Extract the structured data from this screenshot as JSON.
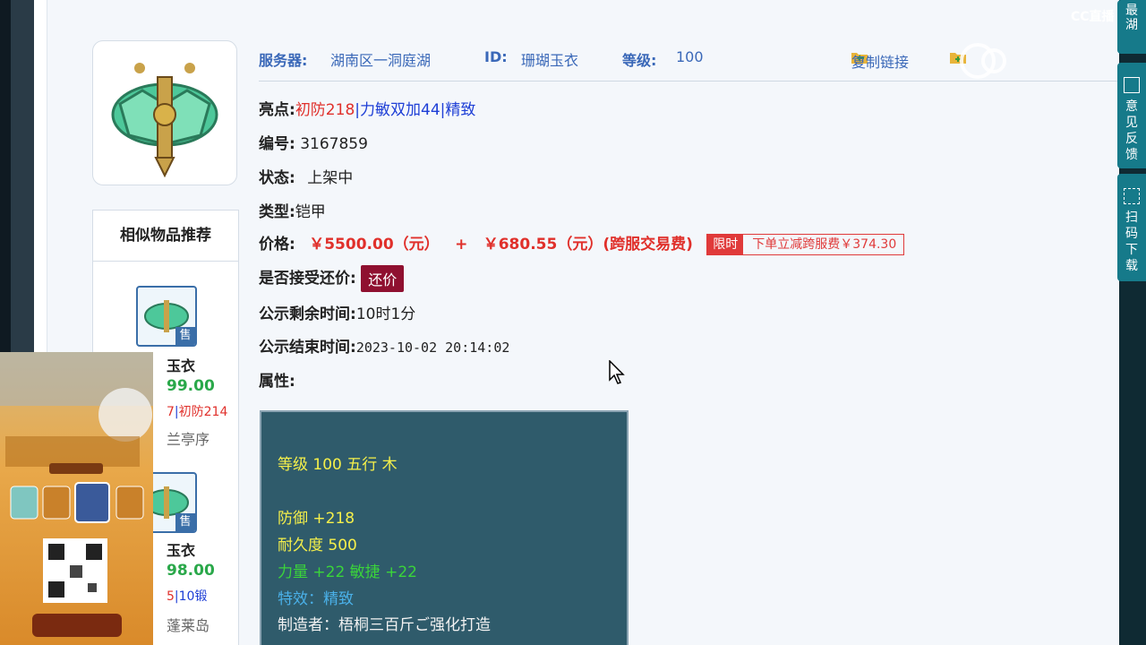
{
  "header": {
    "server_label": "服务器:",
    "server_value": "湖南区一洞庭湖",
    "id_label": "ID:",
    "id_value": "珊瑚玉衣",
    "level_label": "等级:",
    "level_value": "100",
    "copy_link": "复制链接"
  },
  "details": {
    "highlight_label": "亮点:",
    "highlight_1": "初防218",
    "highlight_sep1": "|",
    "highlight_2": "力敏双加44",
    "highlight_sep2": "|",
    "highlight_3": "精致",
    "serial_label": "编号:",
    "serial_value": "3167859",
    "status_label": "状态:",
    "status_value": "上架中",
    "type_label": "类型:",
    "type_value": "铠甲",
    "price_label": "价格:",
    "price_value": "￥5500.00（元）",
    "price_plus": "+",
    "fee_value": "￥680.55（元）(跨服交易费)",
    "limit_tag": "限时",
    "limit_text": "下单立减跨服费￥374.30",
    "counter_label": "是否接受还价:",
    "counter_button": "还价",
    "remaining_label": "公示剩余时间:",
    "remaining_value": "10时1分",
    "end_label": "公示结束时间:",
    "end_value": "2023-10-02 20:14:02",
    "attr_label": "属性:"
  },
  "attributes": {
    "line1": "等级 100 五行 木",
    "line2": "防御 +218",
    "line3": "耐久度 500",
    "line4": "力量 +22 敏捷 +22",
    "line5": "特效：精致",
    "line6": "制造者：梧桐三百斤ご强化打造"
  },
  "similar": {
    "title": "相似物品推荐",
    "sell_badge": "售",
    "items": [
      {
        "name": "玉衣",
        "price": "99.00",
        "tag_a": "7",
        "tag_b": "初防214",
        "server": "兰亭序"
      },
      {
        "name": "玉衣",
        "price": "98.00",
        "tag_a": "5",
        "tag_b": "10锻",
        "server": "蓬莱岛"
      }
    ]
  },
  "right_bar": {
    "btn1": "最湖",
    "btn2": "意见反馈",
    "btn3": "扫码下载"
  },
  "overlay": {
    "cc_top": "CC直播",
    "watermark": "CC直播"
  },
  "colors": {
    "accent_blue": "#3a68b8",
    "price_red": "#e0302b",
    "counter_button": "#8f1030",
    "attr_bg": "#2f5b6b"
  }
}
